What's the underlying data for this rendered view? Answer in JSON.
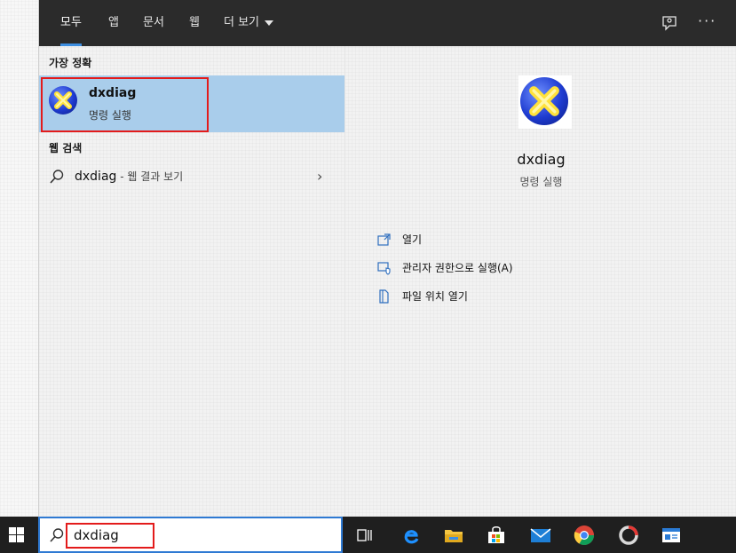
{
  "tabs": [
    {
      "label": "모두",
      "active": true
    },
    {
      "label": "앱"
    },
    {
      "label": "문서"
    },
    {
      "label": "웹"
    },
    {
      "label": "더 보기"
    }
  ],
  "topbar": {
    "feedback_icon": "feedback-icon",
    "more_label": "···"
  },
  "best_match": {
    "section_title": "가장 정확",
    "name": "dxdiag",
    "subtitle": "명령 실행",
    "icon": "directx-icon"
  },
  "web_search": {
    "section_title": "웹 검색",
    "query": "dxdiag",
    "suffix": " - 웹 결과 보기",
    "chevron": "›"
  },
  "detail": {
    "name": "dxdiag",
    "subtitle": "명령 실행",
    "actions": [
      {
        "label": "열기",
        "icon": "open-icon"
      },
      {
        "label": "관리자 권한으로 실행(A)",
        "icon": "admin-shield-icon"
      },
      {
        "label": "파일 위치 열기",
        "icon": "file-location-icon"
      }
    ]
  },
  "taskbar": {
    "search_value": "dxdiag",
    "accent": "#2f7ad3",
    "highlight": "#e31b1b"
  }
}
